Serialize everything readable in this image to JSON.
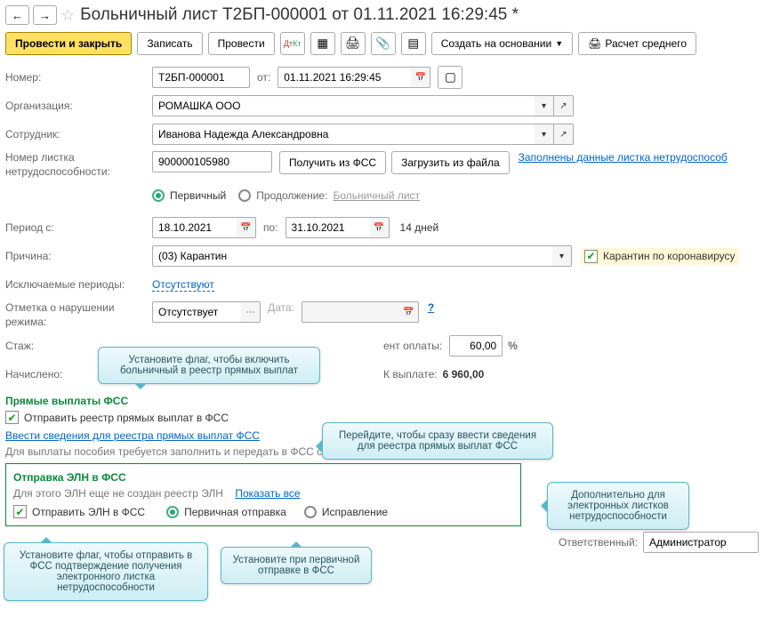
{
  "nav": {
    "back": "←",
    "forward": "→"
  },
  "title": "Больничный лист Т2БП-000001 от 01.11.2021 16:29:45 *",
  "toolbar": {
    "post_close": "Провести и закрыть",
    "save": "Записать",
    "post": "Провести",
    "create_based": "Создать на основании",
    "calc_avg": "Расчет среднего"
  },
  "fields": {
    "number_label": "Номер:",
    "number": "Т2БП-000001",
    "from_label": "от:",
    "date": "01.11.2021 16:29:45",
    "org_label": "Организация:",
    "org": "РОМАШКА ООО",
    "employee_label": "Сотрудник:",
    "employee": "Иванова Надежда Александровна",
    "sheet_no_label": "Номер листка нетрудоспособности:",
    "sheet_no": "900000105980",
    "get_from_fss": "Получить из ФСС",
    "load_from_file": "Загрузить из файла",
    "filled_link": "Заполнены данные листка нетрудоспособ",
    "primary": "Первичный",
    "continuation": "Продолжение:",
    "cont_link": "Больничный лист",
    "period_label": "Период с:",
    "period_from": "18.10.2021",
    "period_to_label": "по:",
    "period_to": "31.10.2021",
    "days": "14 дней",
    "reason_label": "Причина:",
    "reason": "(03) Карантин",
    "covid_checkbox": "Карантин по коронавирусу",
    "excluded_label": "Исключаемые периоды:",
    "excluded_link": "Отсутствуют",
    "violation_label": "Отметка о нарушении режима:",
    "violation": "Отсутствует",
    "date_label2": "Дата:",
    "help": "?",
    "experience_label": "Стаж:",
    "payment_label": "ент оплаты:",
    "payment_pct": "60,00",
    "pct": "%",
    "accrued_label": "Начислено:",
    "to_pay_label": "К выплате:",
    "to_pay": "6 960,00"
  },
  "direct": {
    "heading": "Прямые выплаты ФСС",
    "send_registry": "Отправить реестр прямых выплат в ФСС",
    "enter_info": "Ввести сведения для реестра прямых выплат ФСС",
    "note": "Для выплаты пособия требуется заполнить и передать в ФСС сведения для реестра прямых выплат"
  },
  "eln": {
    "heading": "Отправка ЭЛН в ФСС",
    "subtext": "Для этого ЭЛН еще не создан реестр ЭЛН",
    "show_all": "Показать все",
    "send_eln": "Отправить ЭЛН в ФСС",
    "primary_send": "Первичная отправка",
    "correction": "Исправление"
  },
  "footer": {
    "responsible_label": "Ответственный:",
    "responsible": "Администратор"
  },
  "callouts": {
    "c1": "Установите флаг, чтобы включить больничный в реестр прямых выплат",
    "c2": "Перейдите, чтобы сразу ввести сведения для реестра прямых выплат ФСС",
    "c3": "Дополнительно для электронных листков нетрудоспособности",
    "c4": "Установите флаг, чтобы отправить в ФСС подтверждение получения электронного листка нетрудоспособности",
    "c5": "Установите при первичной отправке в ФСС"
  }
}
